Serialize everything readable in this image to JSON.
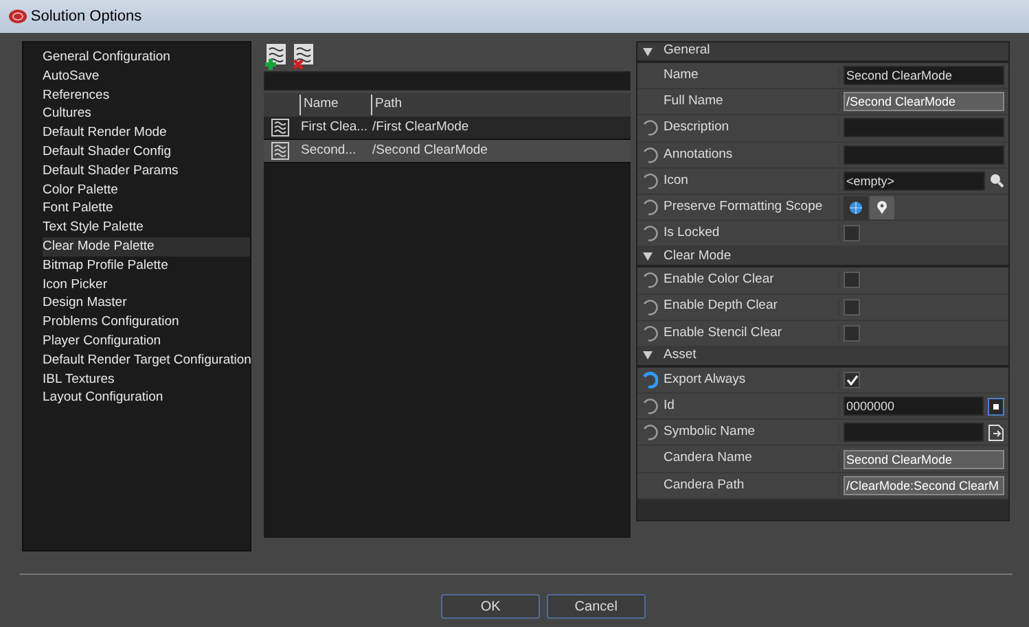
{
  "window": {
    "title": "Solution Options"
  },
  "categories": [
    {
      "label": "General Configuration",
      "selected": false
    },
    {
      "label": "AutoSave",
      "selected": false
    },
    {
      "label": "References",
      "selected": false
    },
    {
      "label": "Cultures",
      "selected": false
    },
    {
      "label": "Default Render Mode",
      "selected": false
    },
    {
      "label": "Default Shader Config",
      "selected": false
    },
    {
      "label": "Default Shader Params",
      "selected": false
    },
    {
      "label": "Color Palette",
      "selected": false
    },
    {
      "label": "Font Palette",
      "selected": false
    },
    {
      "label": "Text Style Palette",
      "selected": false
    },
    {
      "label": "Clear Mode Palette",
      "selected": true
    },
    {
      "label": "Bitmap Profile Palette",
      "selected": false
    },
    {
      "label": "Icon Picker",
      "selected": false
    },
    {
      "label": "Design Master",
      "selected": false
    },
    {
      "label": "Problems Configuration",
      "selected": false
    },
    {
      "label": "Player Configuration",
      "selected": false
    },
    {
      "label": "Default Render Target Configuration",
      "selected": false
    },
    {
      "label": "IBL Textures",
      "selected": false
    },
    {
      "label": "Layout Configuration",
      "selected": false
    }
  ],
  "table": {
    "columns": [
      "Name",
      "Path"
    ],
    "rows": [
      {
        "name": "First Clea...",
        "path": "/First ClearMode",
        "selected": false
      },
      {
        "name": "Second...",
        "path": "/Second ClearMode",
        "selected": true
      }
    ]
  },
  "sections": [
    {
      "title": "General",
      "expanded": true,
      "properties": [
        {
          "label": "Name",
          "kind": "text",
          "resettable": false,
          "modified": false,
          "value": "Second ClearMode"
        },
        {
          "label": "Full Name",
          "kind": "readonly",
          "resettable": false,
          "modified": false,
          "value": "/Second ClearMode"
        },
        {
          "label": "Description",
          "kind": "text",
          "resettable": true,
          "modified": false
        },
        {
          "label": "Annotations",
          "kind": "text",
          "resettable": true,
          "modified": false
        },
        {
          "label": "Icon",
          "kind": "lookup",
          "resettable": true,
          "modified": false,
          "value": "<empty>"
        },
        {
          "label": "Preserve Formatting Scope",
          "kind": "scope",
          "resettable": true,
          "modified": false
        },
        {
          "label": "Is Locked",
          "kind": "checkbox",
          "resettable": true,
          "modified": false,
          "checked": false
        }
      ]
    },
    {
      "title": "Clear Mode",
      "expanded": true,
      "properties": [
        {
          "label": "Enable Color Clear",
          "kind": "checkbox",
          "resettable": true,
          "modified": false,
          "checked": false
        },
        {
          "label": "Enable Depth Clear",
          "kind": "checkbox",
          "resettable": true,
          "modified": false,
          "checked": false
        },
        {
          "label": "Enable Stencil Clear",
          "kind": "checkbox",
          "resettable": true,
          "modified": false,
          "checked": false
        }
      ]
    },
    {
      "title": "Asset",
      "expanded": true,
      "properties": [
        {
          "label": "Export Always",
          "kind": "checkbox",
          "resettable": true,
          "modified": true,
          "checked": true
        },
        {
          "label": "Id",
          "kind": "id",
          "resettable": true,
          "modified": false,
          "value": "0000000"
        },
        {
          "label": "Symbolic Name",
          "kind": "symbolic",
          "resettable": true,
          "modified": false
        },
        {
          "label": "Candera Name",
          "kind": "readonly",
          "resettable": false,
          "modified": false,
          "value": "Second ClearMode"
        },
        {
          "label": "Candera Path",
          "kind": "readonly",
          "resettable": false,
          "modified": false,
          "value": "/ClearMode:Second ClearM"
        }
      ]
    }
  ],
  "buttons": [
    "OK",
    "Cancel"
  ]
}
